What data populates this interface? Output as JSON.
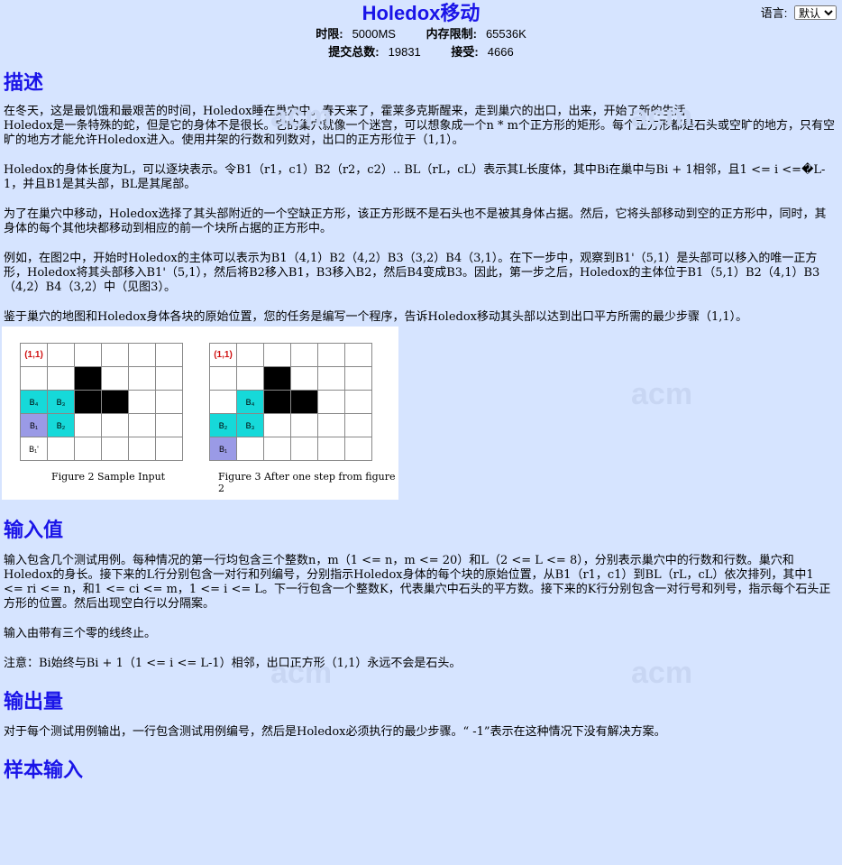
{
  "lang": {
    "label": "语言:",
    "selected": "默认"
  },
  "title": "Holedox移动",
  "meta": {
    "time_label": "时限:",
    "time_value": "5000MS",
    "mem_label": "内存限制:",
    "mem_value": "65536K",
    "submit_label": "提交总数:",
    "submit_value": "19831",
    "accept_label": "接受:",
    "accept_value": "4666"
  },
  "watermark": "acm",
  "sections": {
    "desc_title": "描述",
    "desc_p1": "在冬天，这是最饥饿和最艰苦的时间，Holedox睡在巢穴中。春天来了，霍莱多克斯醒来，走到巢穴的出口，出来，开始了新的生活。",
    "desc_p1b": "Holedox是一条特殊的蛇，但是它的身体不是很长。它的巢穴就像一个迷宫，可以想象成一个n * m个正方形的矩形。每个正方形都是石头或空旷的地方，只有空旷的地方才能允许Holedox进入。使用井架的行数和列数对，出口的正方形位于（1,1）。",
    "desc_p2": "Holedox的身体长度为L，可以逐块表示。令B1（r1，c1）B2（r2，c2）.. BL（rL，cL）表示其L长度体，其中Bi在巢中与Bi + 1相邻，且1 <= i <=�L-1，并且B1是其头部，BL是其尾部。",
    "desc_p3": "为了在巢穴中移动，Holedox选择了其头部附近的一个空缺正方形，该正方形既不是石头也不是被其身体占据。然后，它将头部移动到空的正方形中，同时，其身体的每个其他块都移动到相应的前一个块所占据的正方形中。",
    "desc_p4": "例如，在图2中，开始时Holedox的主体可以表示为B1（4,1）B2（4,2）B3（3,2）B4（3,1）。在下一步中，观察到B1'（5,1）是头部可以移入的唯一正方形，Holedox将其头部移入B1'（5,1），然后将B2移入B1，B3移入B2，然后B4变成B3。因此，第一步之后，Holedox的主体位于B1（5,1）B2（4,1）B3（4,2）B4（3,2）中（见图3）。",
    "desc_p5": "鉴于巢穴的地图和Holedox身体各块的原始位置，您的任务是编写一个程序，告诉Holedox移动其头部以达到出口平方所需的最少步骤（1,1）。",
    "input_title": "输入值",
    "input_p1": "输入包含几个测试用例。每种情况的第一行均包含三个整数n，m（1 <= n，m <= 20）和L（2 <= L <= 8），分别表示巢穴中的行数和行数。巢穴和Holedox的身长。接下来的L行分别包含一对行和列编号，分别指示Holedox身体的每个块的原始位置，从B1（r1，c1）到BL（rL，cL）依次排列，其中1 <= ri <= n，和1 <= ci <= m，1 <= i <= L。下一行包含一个整数K，代表巢穴中石头的平方数。接下来的K行分别包含一对行号和列号，指示每个石头正方形的位置。然后出现空白行以分隔案。",
    "input_p2": "输入由带有三个零的线终止。",
    "input_p3": "注意：Bi始终与Bi + 1（1 <= i <= L-1）相邻，出口正方形（1,1）永远不会是石头。",
    "output_title": "输出量",
    "output_p1": "对于每个测试用例输出，一行包含测试用例编号，然后是Holedox必须执行的最少步骤。“ -1”表示在这种情况下没有解决方案。",
    "sample_title": "样本输入"
  },
  "figure": {
    "corner_label": "(1,1)",
    "fig2_caption": "Figure 2     Sample Input",
    "fig3_caption": "Figure 3     After one step from figure 2",
    "fig2_cells": {
      "B4": "B₄",
      "B3": "B₃",
      "B1": "B₁",
      "B2": "B₂",
      "B1p": "B₁'"
    },
    "fig3_cells": {
      "B4": "B₄",
      "B2": "B₂",
      "B3": "B₃",
      "B1": "B₁"
    }
  }
}
